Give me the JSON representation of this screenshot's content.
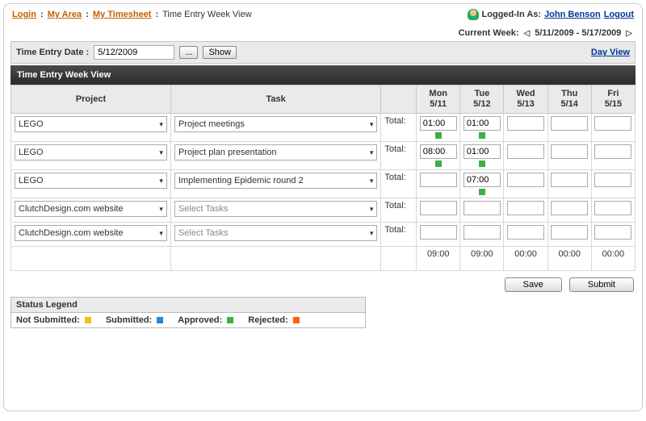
{
  "breadcrumb": {
    "login": "Login",
    "area": "My Area",
    "timesheet": "My Timesheet",
    "current": "Time Entry Week View"
  },
  "user": {
    "logged_in_label": "Logged-In As:",
    "name": "John Benson",
    "logout": "Logout"
  },
  "week": {
    "label": "Current Week:",
    "range": "5/11/2009 - 5/17/2009"
  },
  "datebar": {
    "label": "Time Entry Date :",
    "value": "5/12/2009",
    "browse": "...",
    "show": "Show",
    "dayview": "Day View"
  },
  "title": "Time Entry Week View",
  "headers": {
    "project": "Project",
    "task": "Task",
    "days": [
      {
        "dow": "Mon",
        "date": "5/11"
      },
      {
        "dow": "Tue",
        "date": "5/12"
      },
      {
        "dow": "Wed",
        "date": "5/13"
      },
      {
        "dow": "Thu",
        "date": "5/14"
      },
      {
        "dow": "Fri",
        "date": "5/15"
      }
    ]
  },
  "total_label": "Total:",
  "rows": [
    {
      "project": "LEGO",
      "task": "Project meetings",
      "placeholder": false,
      "cells": [
        "01:00",
        "01:00",
        "",
        "",
        ""
      ],
      "status": [
        "green",
        "green",
        null,
        null,
        null
      ]
    },
    {
      "project": "LEGO",
      "task": "Project plan presentation",
      "placeholder": false,
      "cells": [
        "08:00",
        "01:00",
        "",
        "",
        ""
      ],
      "status": [
        "green",
        "green",
        null,
        null,
        null
      ]
    },
    {
      "project": "LEGO",
      "task": "Implementing Epidemic round 2",
      "placeholder": false,
      "cells": [
        "",
        "07:00",
        "",
        "",
        ""
      ],
      "status": [
        null,
        "green",
        null,
        null,
        null
      ]
    },
    {
      "project": "ClutchDesign.com website",
      "task": "Select Tasks",
      "placeholder": true,
      "cells": [
        "",
        "",
        "",
        "",
        ""
      ],
      "status": [
        null,
        null,
        null,
        null,
        null
      ]
    },
    {
      "project": "ClutchDesign.com website",
      "task": "Select Tasks",
      "placeholder": true,
      "cells": [
        "",
        "",
        "",
        "",
        ""
      ],
      "status": [
        null,
        null,
        null,
        null,
        null
      ]
    }
  ],
  "col_totals": [
    "09:00",
    "09:00",
    "00:00",
    "00:00",
    "00:00"
  ],
  "buttons": {
    "save": "Save",
    "submit": "Submit"
  },
  "legend": {
    "title": "Status Legend",
    "not_submitted": "Not Submitted:",
    "submitted": "Submitted:",
    "approved": "Approved:",
    "rejected": "Rejected:"
  },
  "status_colors": {
    "green": "#3cb043",
    "yellow": "#f4c20d",
    "blue": "#1e88e5",
    "orange": "#ff5e13"
  }
}
